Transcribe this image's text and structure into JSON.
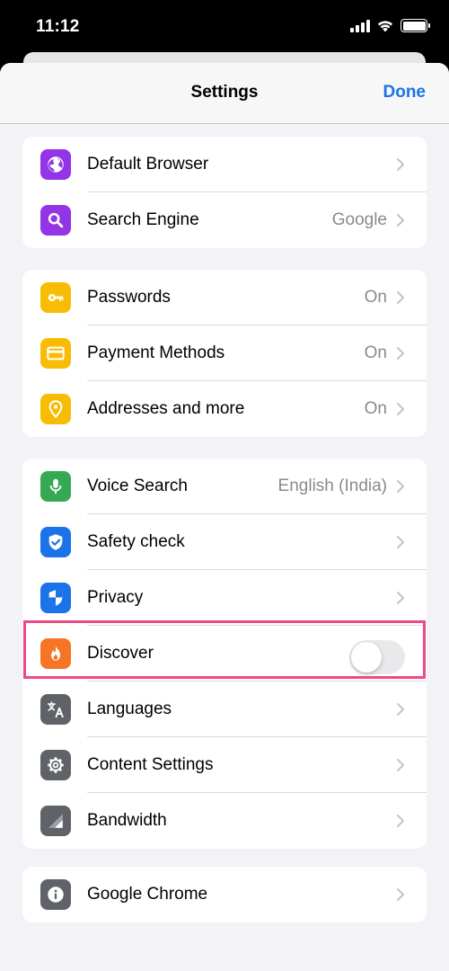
{
  "status_bar": {
    "time": "11:12"
  },
  "nav": {
    "title": "Settings",
    "done_label": "Done"
  },
  "colors": {
    "accent": "#1a73e8",
    "purple": "#9334e6",
    "yellow": "#f9bc04",
    "green": "#34a853",
    "blue": "#1a73e8",
    "orange": "#f57524",
    "gray": "#5f6368",
    "highlight": "#ec4a88"
  },
  "groups": [
    {
      "items": [
        {
          "label": "Default Browser",
          "icon": "globe-icon",
          "detail": ""
        },
        {
          "label": "Search Engine",
          "icon": "search-icon",
          "detail": "Google"
        }
      ]
    },
    {
      "items": [
        {
          "label": "Passwords",
          "icon": "key-icon",
          "detail": "On"
        },
        {
          "label": "Payment Methods",
          "icon": "credit-card-icon",
          "detail": "On"
        },
        {
          "label": "Addresses and more",
          "icon": "location-pin-icon",
          "detail": "On"
        }
      ]
    },
    {
      "items": [
        {
          "label": "Voice Search",
          "icon": "microphone-icon",
          "detail": "English (India)"
        },
        {
          "label": "Safety check",
          "icon": "shield-check-icon",
          "detail": ""
        },
        {
          "label": "Privacy",
          "icon": "shield-icon",
          "detail": ""
        },
        {
          "label": "Discover",
          "icon": "flame-icon",
          "detail": "",
          "toggle": false
        },
        {
          "label": "Languages",
          "icon": "translate-icon",
          "detail": ""
        },
        {
          "label": "Content Settings",
          "icon": "gear-icon",
          "detail": ""
        },
        {
          "label": "Bandwidth",
          "icon": "signal-bars-icon",
          "detail": ""
        }
      ]
    },
    {
      "items": [
        {
          "label": "Google Chrome",
          "icon": "info-icon",
          "detail": ""
        }
      ]
    }
  ]
}
